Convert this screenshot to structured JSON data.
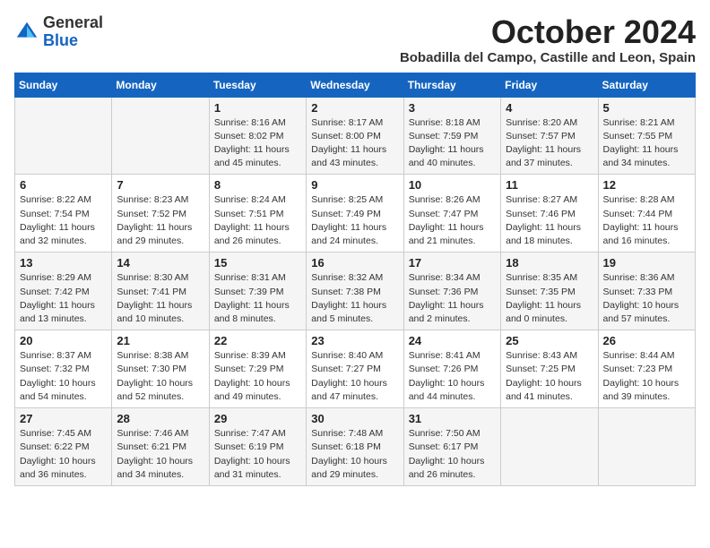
{
  "header": {
    "logo_line1": "General",
    "logo_line2": "Blue",
    "month": "October 2024",
    "location": "Bobadilla del Campo, Castille and Leon, Spain"
  },
  "weekdays": [
    "Sunday",
    "Monday",
    "Tuesday",
    "Wednesday",
    "Thursday",
    "Friday",
    "Saturday"
  ],
  "weeks": [
    [
      {
        "day": "",
        "detail": ""
      },
      {
        "day": "",
        "detail": ""
      },
      {
        "day": "1",
        "detail": "Sunrise: 8:16 AM\nSunset: 8:02 PM\nDaylight: 11 hours and 45 minutes."
      },
      {
        "day": "2",
        "detail": "Sunrise: 8:17 AM\nSunset: 8:00 PM\nDaylight: 11 hours and 43 minutes."
      },
      {
        "day": "3",
        "detail": "Sunrise: 8:18 AM\nSunset: 7:59 PM\nDaylight: 11 hours and 40 minutes."
      },
      {
        "day": "4",
        "detail": "Sunrise: 8:20 AM\nSunset: 7:57 PM\nDaylight: 11 hours and 37 minutes."
      },
      {
        "day": "5",
        "detail": "Sunrise: 8:21 AM\nSunset: 7:55 PM\nDaylight: 11 hours and 34 minutes."
      }
    ],
    [
      {
        "day": "6",
        "detail": "Sunrise: 8:22 AM\nSunset: 7:54 PM\nDaylight: 11 hours and 32 minutes."
      },
      {
        "day": "7",
        "detail": "Sunrise: 8:23 AM\nSunset: 7:52 PM\nDaylight: 11 hours and 29 minutes."
      },
      {
        "day": "8",
        "detail": "Sunrise: 8:24 AM\nSunset: 7:51 PM\nDaylight: 11 hours and 26 minutes."
      },
      {
        "day": "9",
        "detail": "Sunrise: 8:25 AM\nSunset: 7:49 PM\nDaylight: 11 hours and 24 minutes."
      },
      {
        "day": "10",
        "detail": "Sunrise: 8:26 AM\nSunset: 7:47 PM\nDaylight: 11 hours and 21 minutes."
      },
      {
        "day": "11",
        "detail": "Sunrise: 8:27 AM\nSunset: 7:46 PM\nDaylight: 11 hours and 18 minutes."
      },
      {
        "day": "12",
        "detail": "Sunrise: 8:28 AM\nSunset: 7:44 PM\nDaylight: 11 hours and 16 minutes."
      }
    ],
    [
      {
        "day": "13",
        "detail": "Sunrise: 8:29 AM\nSunset: 7:42 PM\nDaylight: 11 hours and 13 minutes."
      },
      {
        "day": "14",
        "detail": "Sunrise: 8:30 AM\nSunset: 7:41 PM\nDaylight: 11 hours and 10 minutes."
      },
      {
        "day": "15",
        "detail": "Sunrise: 8:31 AM\nSunset: 7:39 PM\nDaylight: 11 hours and 8 minutes."
      },
      {
        "day": "16",
        "detail": "Sunrise: 8:32 AM\nSunset: 7:38 PM\nDaylight: 11 hours and 5 minutes."
      },
      {
        "day": "17",
        "detail": "Sunrise: 8:34 AM\nSunset: 7:36 PM\nDaylight: 11 hours and 2 minutes."
      },
      {
        "day": "18",
        "detail": "Sunrise: 8:35 AM\nSunset: 7:35 PM\nDaylight: 11 hours and 0 minutes."
      },
      {
        "day": "19",
        "detail": "Sunrise: 8:36 AM\nSunset: 7:33 PM\nDaylight: 10 hours and 57 minutes."
      }
    ],
    [
      {
        "day": "20",
        "detail": "Sunrise: 8:37 AM\nSunset: 7:32 PM\nDaylight: 10 hours and 54 minutes."
      },
      {
        "day": "21",
        "detail": "Sunrise: 8:38 AM\nSunset: 7:30 PM\nDaylight: 10 hours and 52 minutes."
      },
      {
        "day": "22",
        "detail": "Sunrise: 8:39 AM\nSunset: 7:29 PM\nDaylight: 10 hours and 49 minutes."
      },
      {
        "day": "23",
        "detail": "Sunrise: 8:40 AM\nSunset: 7:27 PM\nDaylight: 10 hours and 47 minutes."
      },
      {
        "day": "24",
        "detail": "Sunrise: 8:41 AM\nSunset: 7:26 PM\nDaylight: 10 hours and 44 minutes."
      },
      {
        "day": "25",
        "detail": "Sunrise: 8:43 AM\nSunset: 7:25 PM\nDaylight: 10 hours and 41 minutes."
      },
      {
        "day": "26",
        "detail": "Sunrise: 8:44 AM\nSunset: 7:23 PM\nDaylight: 10 hours and 39 minutes."
      }
    ],
    [
      {
        "day": "27",
        "detail": "Sunrise: 7:45 AM\nSunset: 6:22 PM\nDaylight: 10 hours and 36 minutes."
      },
      {
        "day": "28",
        "detail": "Sunrise: 7:46 AM\nSunset: 6:21 PM\nDaylight: 10 hours and 34 minutes."
      },
      {
        "day": "29",
        "detail": "Sunrise: 7:47 AM\nSunset: 6:19 PM\nDaylight: 10 hours and 31 minutes."
      },
      {
        "day": "30",
        "detail": "Sunrise: 7:48 AM\nSunset: 6:18 PM\nDaylight: 10 hours and 29 minutes."
      },
      {
        "day": "31",
        "detail": "Sunrise: 7:50 AM\nSunset: 6:17 PM\nDaylight: 10 hours and 26 minutes."
      },
      {
        "day": "",
        "detail": ""
      },
      {
        "day": "",
        "detail": ""
      }
    ]
  ]
}
